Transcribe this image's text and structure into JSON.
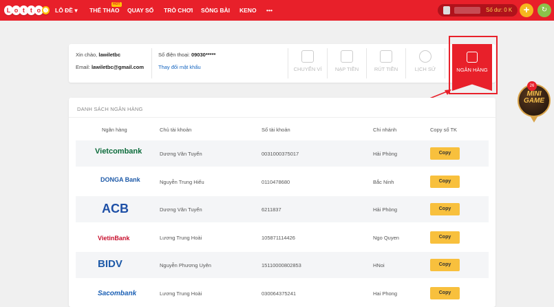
{
  "colors": {
    "brand_red": "#e8202a",
    "copy_yellow": "#f8c03d",
    "link_blue": "#1565c0"
  },
  "logo": {
    "letters": [
      "L",
      "o",
      "t",
      "t",
      "o"
    ],
    "accent": "❺"
  },
  "nav": {
    "items": [
      "LÔ ĐỀ ▾",
      "THỂ THAO",
      "QUAY SỐ",
      "TRÒ CHƠI",
      "SÒNG BÀI",
      "KENO",
      "•••"
    ],
    "hot_badge": "HOT"
  },
  "account": {
    "balance_label": "Số dư: 0 K",
    "plus_icon": "+",
    "refresh_icon": "↻"
  },
  "profile": {
    "greeting_label": "Xin chào,",
    "username": "lawiletbc",
    "email_label": "Email:",
    "email": "lawiletbc@gmail.com",
    "phone_label": "Số điện thoại:",
    "phone": "09030*****",
    "change_password": "Thay đổi mật khẩu"
  },
  "actions": [
    {
      "label": "CHUYỂN VÍ",
      "icon": "wallet-icon"
    },
    {
      "label": "NẠP TIỀN",
      "icon": "deposit-icon"
    },
    {
      "label": "RÚT TIỀN",
      "icon": "withdraw-icon"
    },
    {
      "label": "LỊCH SỬ",
      "icon": "history-icon"
    }
  ],
  "active_action": {
    "label": "NGÂN HÀNG",
    "icon": "bank-icon"
  },
  "mini_game": {
    "badge": "26",
    "text_top": "MINI",
    "text_bottom": "GAME"
  },
  "bank_list": {
    "title": "DANH SÁCH NGÂN HÀNG",
    "headers": [
      "Ngân hàng",
      "Chủ tài khoản",
      "Số tài khoản",
      "Chi nhánh",
      "Copy số TK"
    ],
    "copy_label": "Copy",
    "rows": [
      {
        "bank": "Vietcombank",
        "owner": "Dương Văn Tuyển",
        "account": "0031000375017",
        "branch": "Hải Phòng"
      },
      {
        "bank": "DONGA Bank",
        "owner": "Nguyễn Trung Hiếu",
        "account": "0110478680",
        "branch": "Bắc Ninh"
      },
      {
        "bank": "ACB",
        "owner": "Dương Văn Tuyển",
        "account": "6211837",
        "branch": "Hải Phòng"
      },
      {
        "bank": "VietinBank",
        "owner": "Lương Trung Hoài",
        "account": "105871114426",
        "branch": "Ngo Quyen"
      },
      {
        "bank": "BIDV",
        "owner": "Nguyễn Phương Uyên",
        "account": "15110000802853",
        "branch": "HNoi"
      },
      {
        "bank": "Sacombank",
        "owner": "Lương Trung Hoài",
        "account": "030064375241",
        "branch": "Hai Phong"
      }
    ]
  }
}
